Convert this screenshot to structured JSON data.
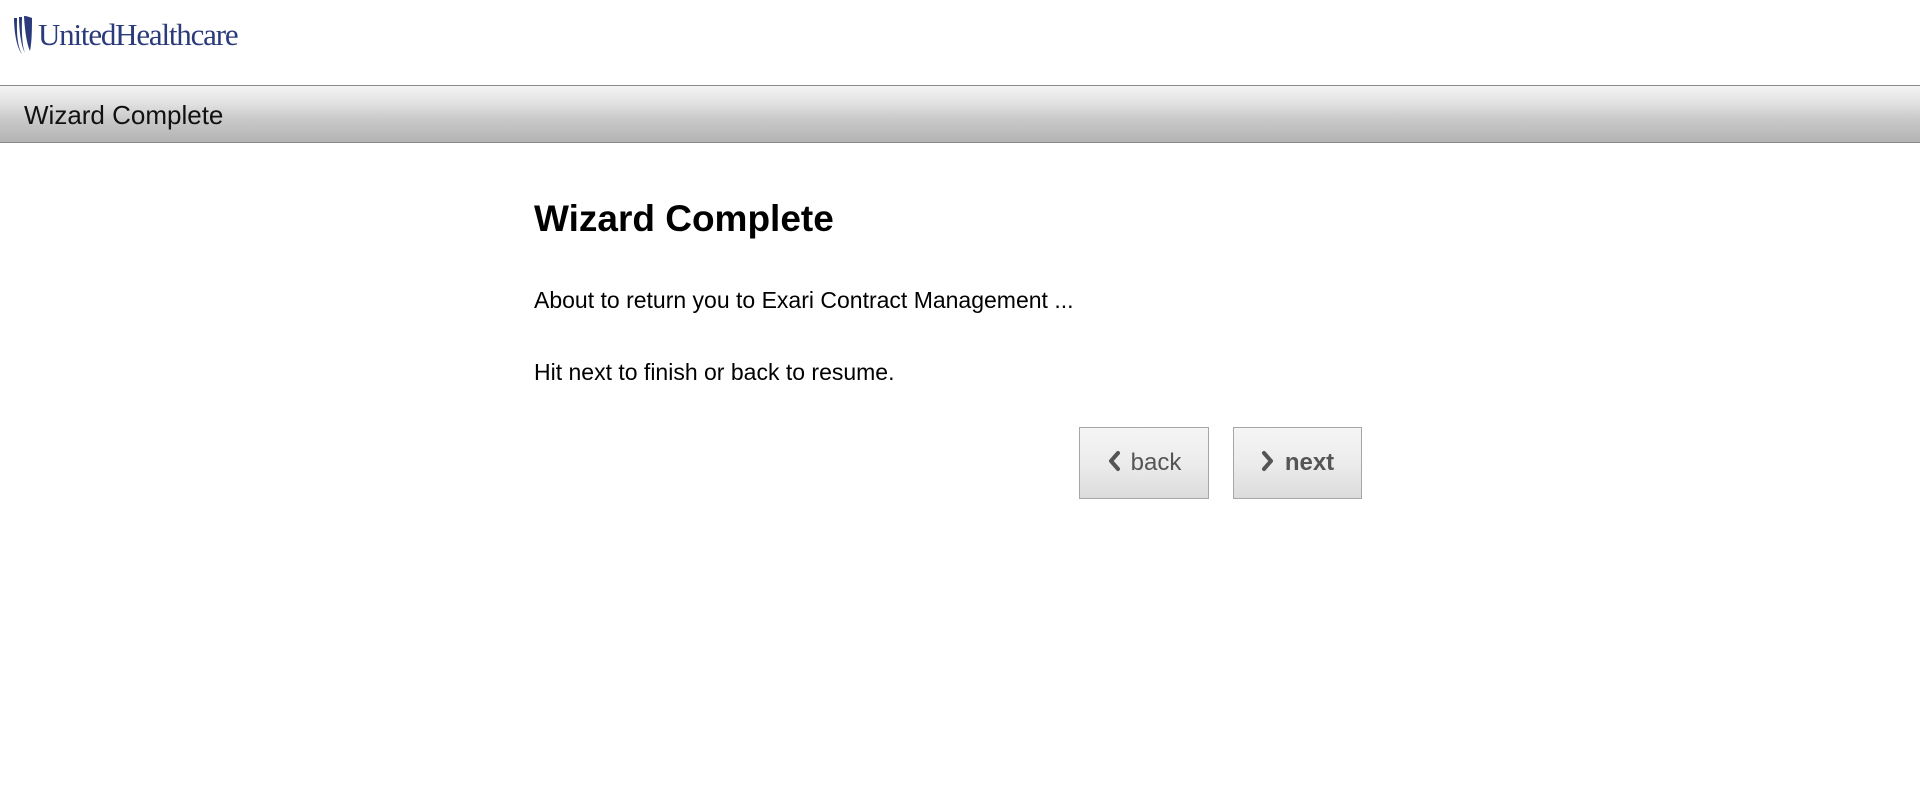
{
  "brand": {
    "name": "UnitedHealthcare",
    "color": "#2b3a7a"
  },
  "header": {
    "title": "Wizard Complete"
  },
  "main": {
    "heading": "Wizard Complete",
    "message": "About to return you to Exari Contract Management ...",
    "instruction": "Hit next to finish or back to resume."
  },
  "buttons": {
    "back_label": "back",
    "back_icon": "chevron-left-icon",
    "next_label": "next",
    "next_icon": "chevron-right-icon"
  }
}
